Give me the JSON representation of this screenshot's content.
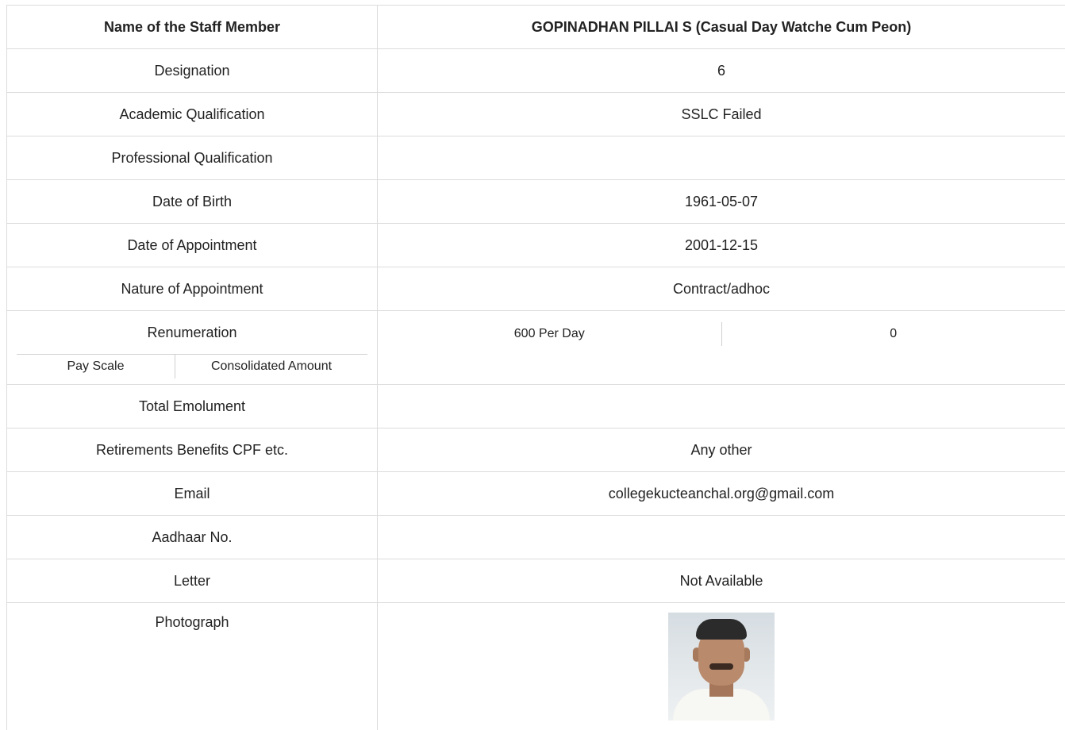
{
  "header": {
    "label": "Name of the Staff Member",
    "value": "GOPINADHAN PILLAI S (Casual Day Watche Cum Peon)"
  },
  "rows": [
    {
      "label": "Designation",
      "value": "6"
    },
    {
      "label": "Academic Qualification",
      "value": "SSLC Failed"
    },
    {
      "label": "Professional Qualification",
      "value": ""
    },
    {
      "label": "Date of Birth",
      "value": "1961-05-07"
    },
    {
      "label": "Date of Appointment",
      "value": "2001-12-15"
    },
    {
      "label": "Nature of Appointment",
      "value": "Contract/adhoc"
    }
  ],
  "renumeration": {
    "label": "Renumeration",
    "sub_labels": [
      "Pay Scale",
      "Consolidated Amount"
    ],
    "pay_scale": "600 Per Day",
    "consolidated_amount": "0"
  },
  "rows2": [
    {
      "label": "Total Emolument",
      "value": ""
    },
    {
      "label": "Retirements Benefits CPF etc.",
      "value": "Any other"
    },
    {
      "label": "Email",
      "value": "collegekucteanchal.org@gmail.com"
    },
    {
      "label": "Aadhaar No.",
      "value": ""
    },
    {
      "label": "Letter",
      "value": "Not Available"
    }
  ],
  "photograph": {
    "label": "Photograph",
    "image": "staff-photo"
  }
}
